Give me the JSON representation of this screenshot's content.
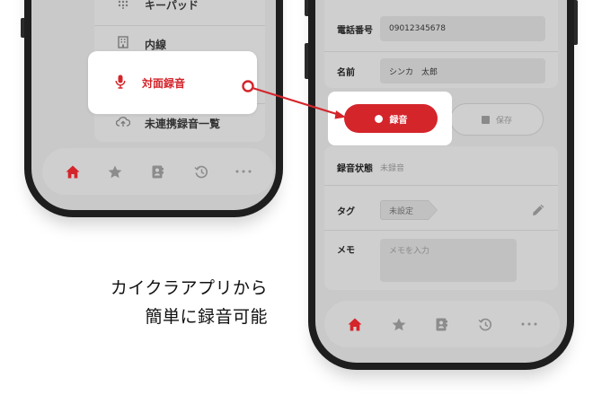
{
  "left_screen": {
    "menu_items": [
      {
        "label": "キーパッド",
        "icon": "keypad-icon"
      },
      {
        "label": "内線",
        "icon": "building-icon"
      },
      {
        "label": "対面録音",
        "icon": "microphone-icon"
      },
      {
        "label": "未連携録音一覧",
        "icon": "cloud-upload-icon"
      }
    ],
    "tabs": [
      "home-icon",
      "star-icon",
      "contacts-icon",
      "history-icon",
      "more-icon"
    ]
  },
  "right_screen": {
    "phone": {
      "label": "電話番号",
      "value": "09012345678"
    },
    "name": {
      "label": "名前",
      "value": "シンカ　太郎"
    },
    "record_button": "録音",
    "save_button": "保存",
    "status": {
      "label": "録音状態",
      "value": "未録音"
    },
    "tag": {
      "label": "タグ",
      "value": "未設定"
    },
    "memo": {
      "label": "メモ",
      "placeholder": "メモを入力"
    },
    "tabs": [
      "home-icon",
      "star-icon",
      "contacts-icon",
      "history-icon",
      "more-icon"
    ]
  },
  "caption": {
    "line1": "カイクラアプリから",
    "line2": "簡単に録音可能"
  },
  "colors": {
    "accent": "#d4252b",
    "screen_bg": "#c9c9c9",
    "frame": "#1e1e1e"
  }
}
